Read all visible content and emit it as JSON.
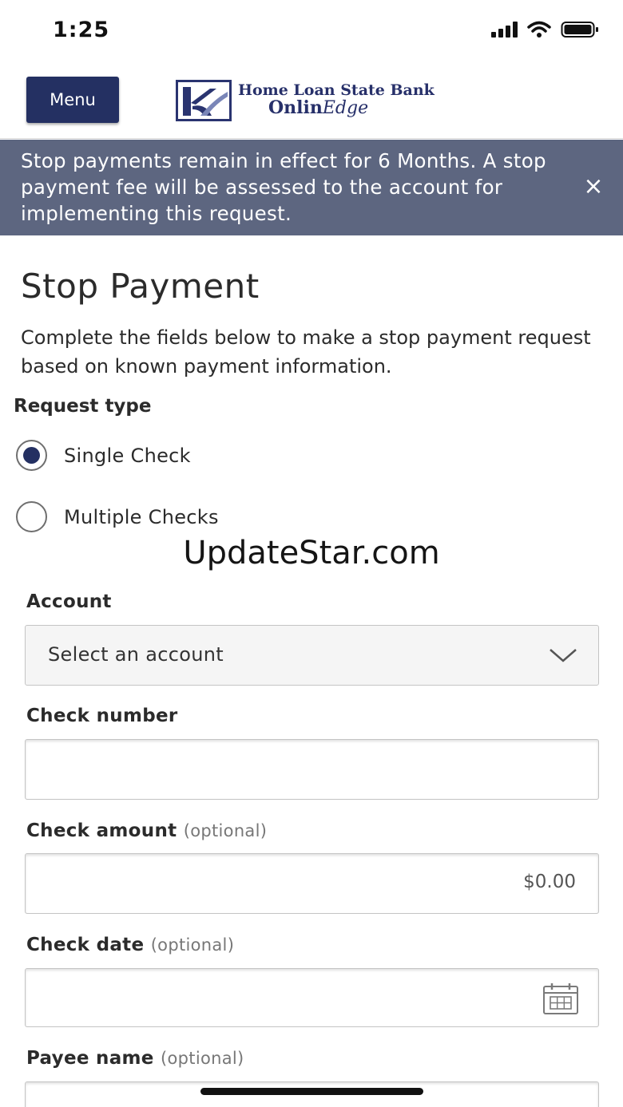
{
  "status_bar": {
    "time": "1:25"
  },
  "header": {
    "menu_label": "Menu",
    "logo_line1": "Home Loan State Bank",
    "logo_line2_main": "Onlin",
    "logo_line2_italic": "Edge"
  },
  "banner": {
    "text": "Stop payments remain in effect for 6 Months. A stop payment fee will be assessed to the account for implementing this request.",
    "close_glyph": "×"
  },
  "page": {
    "title": "Stop Payment",
    "description": "Complete the fields below to make a stop payment request based on known payment information."
  },
  "request_type": {
    "label": "Request type",
    "options": [
      {
        "label": "Single Check",
        "selected": true
      },
      {
        "label": "Multiple Checks",
        "selected": false
      }
    ]
  },
  "watermark": "UpdateStar.com",
  "fields": {
    "account": {
      "label": "Account",
      "value": "Select an account"
    },
    "check_number": {
      "label": "Check number",
      "value": ""
    },
    "check_amount": {
      "label": "Check amount",
      "optional": "(optional)",
      "value": "$0.00"
    },
    "check_date": {
      "label": "Check date",
      "optional": "(optional)",
      "value": ""
    },
    "payee_name": {
      "label": "Payee name",
      "optional": "(optional)",
      "value": ""
    }
  },
  "colors": {
    "brand_navy": "#243062",
    "banner_bg": "#5d6680"
  }
}
